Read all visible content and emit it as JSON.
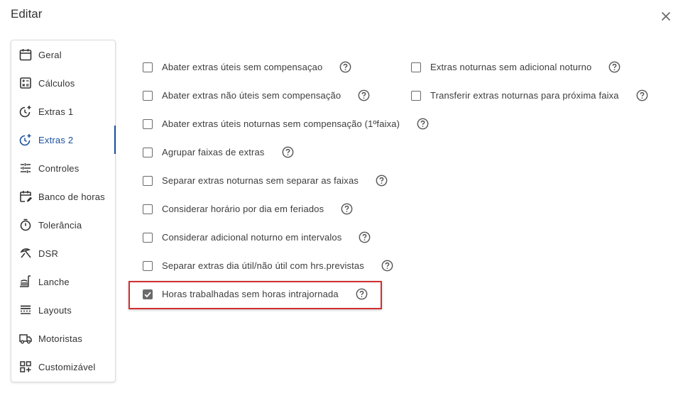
{
  "dialog": {
    "title": "Editar",
    "close_icon": "close-icon"
  },
  "sidebar": {
    "active_color": "#1a4f9c",
    "items": [
      {
        "label": "Geral",
        "icon": "calendar-icon"
      },
      {
        "label": "Cálculos",
        "icon": "calculator-icon"
      },
      {
        "label": "Extras 1",
        "icon": "clock-plus-icon"
      },
      {
        "label": "Extras 2",
        "icon": "clock-plus-icon",
        "active": true
      },
      {
        "label": "Controles",
        "icon": "sliders-icon"
      },
      {
        "label": "Banco de horas",
        "icon": "calendar-edit-icon"
      },
      {
        "label": "Tolerância",
        "icon": "timer-icon"
      },
      {
        "label": "DSR",
        "icon": "beach-icon"
      },
      {
        "label": "Lanche",
        "icon": "lunch-icon"
      },
      {
        "label": "Layouts",
        "icon": "layout-icon"
      },
      {
        "label": "Motoristas",
        "icon": "truck-icon"
      },
      {
        "label": "Customizável",
        "icon": "grid-plus-icon"
      }
    ]
  },
  "options_left": [
    {
      "label": "Abater extras úteis sem compensaçao",
      "checked": false
    },
    {
      "label": "Abater extras não úteis sem compensação",
      "checked": false
    },
    {
      "label": "Abater extras úteis noturnas sem compensação (1ºfaixa)",
      "checked": false
    },
    {
      "label": "Agrupar faixas de extras",
      "checked": false
    },
    {
      "label": "Separar extras noturnas sem separar as faixas",
      "checked": false
    },
    {
      "label": "Considerar horário por dia em feriados",
      "checked": false
    },
    {
      "label": "Considerar adicional noturno em intervalos",
      "checked": false
    },
    {
      "label": "Separar extras dia útil/não útil com hrs.previstas",
      "checked": false
    },
    {
      "label": "Horas trabalhadas sem horas intrajornada",
      "checked": true
    }
  ],
  "options_right": [
    {
      "label": "Extras noturnas sem adicional noturno",
      "checked": false
    },
    {
      "label": "Transferir extras noturnas para próxima faixa",
      "checked": false
    }
  ],
  "highlight_color": "#d32f2f"
}
